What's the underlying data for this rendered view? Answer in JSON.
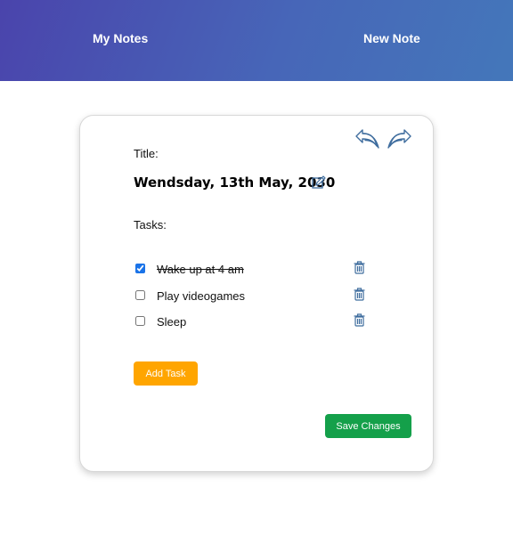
{
  "navbar": {
    "my_notes_label": "My Notes",
    "new_note_label": "New Note",
    "gradient_start": "#4a44ac",
    "gradient_end": "#4477ba"
  },
  "note": {
    "title_label": "Title:",
    "title": "Wendsday, 13th May, 2030",
    "tasks_label": "Tasks:",
    "tasks": [
      {
        "text": "Wake up at 4 am",
        "done": true
      },
      {
        "text": "Play videogames",
        "done": false
      },
      {
        "text": "Sleep",
        "done": false
      }
    ]
  },
  "actions": {
    "add_task_label": "Add Task",
    "save_label": "Save Changes",
    "add_task_color": "#ffa500",
    "save_color": "#14a04a"
  },
  "icons": {
    "undo": "undo-icon",
    "redo": "redo-icon",
    "edit": "edit-icon",
    "delete": "trash-icon"
  }
}
